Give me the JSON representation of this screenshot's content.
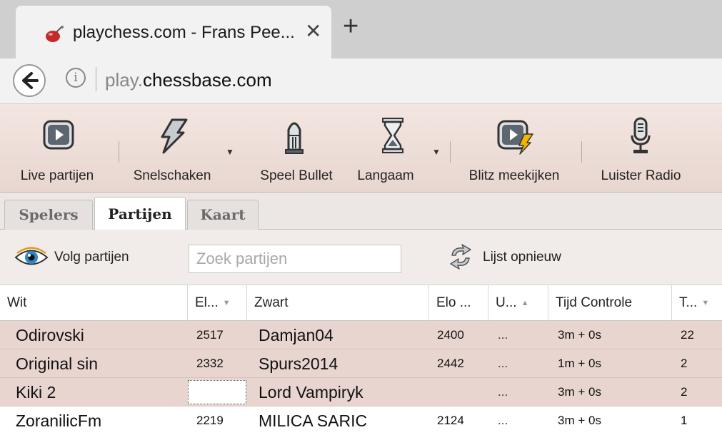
{
  "browser": {
    "tab_title": "playchess.com - Frans Pee...",
    "tab_close": "✕",
    "new_tab": "+",
    "url_prefix": "play.",
    "url_domain": "chessbase.com",
    "info": "i"
  },
  "toolbar": {
    "items": [
      {
        "label": "Live partijen",
        "icon": "play-screen-icon"
      },
      {
        "label": "Snelschaken",
        "icon": "lightning-icon",
        "has_dropdown": true
      },
      {
        "label": "Speel Bullet",
        "icon": "bullet-icon"
      },
      {
        "label": "Langaam",
        "icon": "hourglass-icon",
        "has_dropdown": true
      },
      {
        "label": "Blitz meekijken",
        "icon": "play-lightning-icon"
      },
      {
        "label": "Luister Radio",
        "icon": "microphone-icon"
      }
    ],
    "caret": "▼"
  },
  "tabs": [
    {
      "label": "Spelers",
      "active": false
    },
    {
      "label": "Partijen",
      "active": true
    },
    {
      "label": "Kaart",
      "active": false
    }
  ],
  "actions": {
    "follow_label": "Volg partijen",
    "search_placeholder": "Zoek partijen",
    "refresh_label": "Lijst opnieuw"
  },
  "table": {
    "columns": [
      "Wit",
      "El...",
      "Zwart",
      "Elo ...",
      "U...",
      "Tijd Controle",
      "T..."
    ],
    "rows": [
      {
        "white": "Odirovski",
        "white_elo": "2517",
        "black": "Damjan04",
        "black_elo": "2400",
        "u": "...",
        "time_control": "3m + 0s",
        "t": "22"
      },
      {
        "white": "Original sin",
        "white_elo": "2332",
        "black": "Spurs2014",
        "black_elo": "2442",
        "u": "...",
        "time_control": "1m + 0s",
        "t": "2"
      },
      {
        "white": "Kiki 2",
        "white_elo": "",
        "black": "Lord Vampiryk",
        "black_elo": "",
        "u": "...",
        "time_control": "3m + 0s",
        "t": "2"
      },
      {
        "white": "ZoranilicFm",
        "white_elo": "2219",
        "black": "MILICA SARIC",
        "black_elo": "2124",
        "u": "...",
        "time_control": "3m + 0s",
        "t": "1"
      }
    ]
  },
  "colors": {
    "toolbar_bg": "#f0e1db",
    "row_shade": "#e8d5cf",
    "tab_strip": "#cfcfcf"
  }
}
